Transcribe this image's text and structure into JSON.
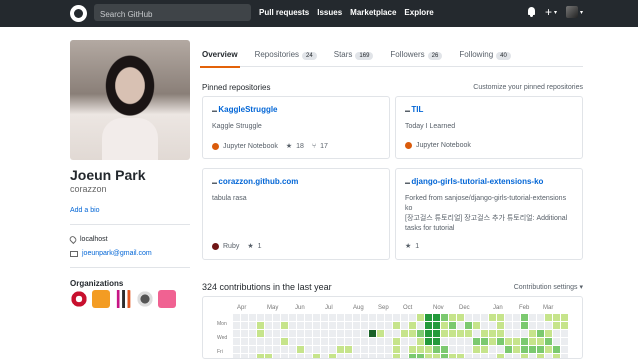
{
  "header": {
    "search_placeholder": "Search GitHub",
    "nav": [
      "Pull requests",
      "Issues",
      "Marketplace",
      "Explore"
    ],
    "plus": "+",
    "caret": "▾"
  },
  "profile": {
    "name": "Joeun Park",
    "login": "corazzon",
    "add_bio": "Add a bio",
    "location": "localhost",
    "email": "joeunpark@gmail.com",
    "organizations_title": "Organizations",
    "organizations": [
      {
        "name": "org-red-circle",
        "color": "#c8102e"
      },
      {
        "name": "org-orange",
        "color": "#f39c23"
      },
      {
        "name": "org-text-logo",
        "color": "#ffffff"
      },
      {
        "name": "org-round",
        "color": "#eeeeee"
      },
      {
        "name": "org-pink",
        "color": "#f06292"
      }
    ]
  },
  "tabs": [
    {
      "label": "Overview",
      "count": "",
      "selected": true
    },
    {
      "label": "Repositories",
      "count": "24",
      "selected": false
    },
    {
      "label": "Stars",
      "count": "169",
      "selected": false
    },
    {
      "label": "Followers",
      "count": "26",
      "selected": false
    },
    {
      "label": "Following",
      "count": "40",
      "selected": false
    }
  ],
  "pinned": {
    "title": "Pinned repositories",
    "customize": "Customize your pinned repositories",
    "repos": [
      {
        "name": "KaggleStruggle",
        "description": "Kaggle Struggle",
        "language": "Jupyter Notebook",
        "lang_color": "#da5b0b",
        "stars": "18",
        "forks": "17"
      },
      {
        "name": "TIL",
        "description": "Today I Learned",
        "language": "Jupyter Notebook",
        "lang_color": "#da5b0b",
        "stars": "",
        "forks": ""
      },
      {
        "name": "corazzon.github.com",
        "description": "tabula rasa",
        "language": "Ruby",
        "lang_color": "#701516",
        "stars": "1",
        "forks": ""
      },
      {
        "name": "django-girls-tutorial-extensions-ko",
        "description": "Forked from sanjose/django-girls-tutorial-extensions ko",
        "description2": "[장고걸스 튜토리얼] 장고걸스 추가 튜토리얼: Additional tasks for tutorial",
        "language": "",
        "lang_color": "",
        "stars": "1",
        "forks": ""
      }
    ]
  },
  "contributions": {
    "title": "324 contributions in the last year",
    "settings": "Contribution settings ▾",
    "months": [
      "Apr",
      "May",
      "Jun",
      "Jul",
      "Aug",
      "Sep",
      "Oct",
      "Nov",
      "Dec",
      "Jan",
      "Feb",
      "Mar"
    ],
    "days": [
      "Mon",
      "Wed",
      "Fri"
    ],
    "colors": [
      "#ebedf0",
      "#c6e48b",
      "#7bc96f",
      "#239a3b",
      "#196127"
    ]
  }
}
